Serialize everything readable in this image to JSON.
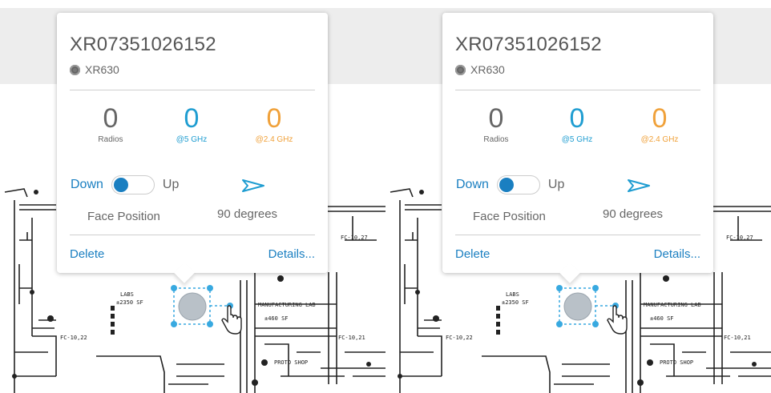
{
  "panels": [
    {
      "card": {
        "title": "XR07351026152",
        "model": "XR630",
        "stats": [
          {
            "value": "0",
            "label": "Radios"
          },
          {
            "value": "0",
            "label": "@5 GHz"
          },
          {
            "value": "0",
            "label": "@2.4 GHz"
          }
        ],
        "toggle": {
          "off_label": "Down",
          "on_label": "Up",
          "state": "Down"
        },
        "face_position_label": "Face Position",
        "degrees": "90 degrees",
        "delete_label": "Delete",
        "details_label": "Details..."
      }
    },
    {
      "card": {
        "title": "XR07351026152",
        "model": "XR630",
        "stats": [
          {
            "value": "0",
            "label": "Radios"
          },
          {
            "value": "0",
            "label": "@5 GHz"
          },
          {
            "value": "0",
            "label": "@2.4 GHz"
          }
        ],
        "toggle": {
          "off_label": "Down",
          "on_label": "Up",
          "state": "Down"
        },
        "face_position_label": "Face Position",
        "degrees": "90 degrees",
        "delete_label": "Delete",
        "details_label": "Details..."
      }
    }
  ],
  "floorplan": {
    "labels": [
      "LABS",
      "±2350 SF",
      "MANUFACTURING LAB",
      "±460 SF",
      "PROTO SHOP",
      "FC-10,27",
      "FC-10,21",
      "FC-10,22"
    ]
  },
  "colors": {
    "accent_blue": "#1a7fc1",
    "ghz5": "#1f9dd1",
    "ghz24": "#f0a13a"
  },
  "icons": [
    "model-radio-icon",
    "face-direction-arrow-icon",
    "hand-cursor-icon"
  ]
}
